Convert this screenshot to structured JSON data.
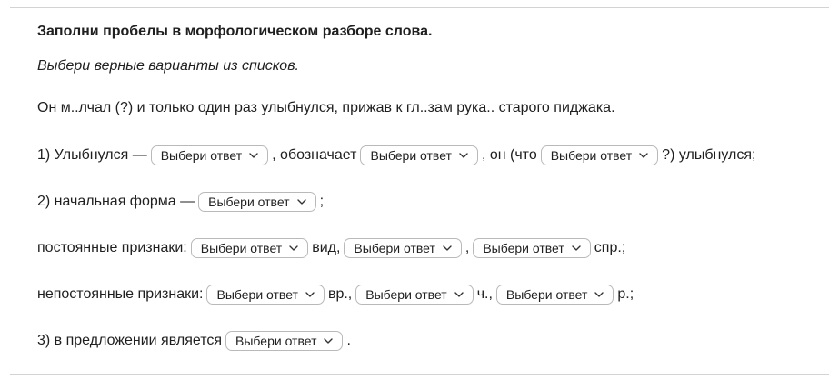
{
  "task": {
    "title": "Заполни пробелы в морфологическом разборе слова.",
    "instruction": "Выбери верные варианты из списков.",
    "sentence": "Он м..лчал (?) и только один раз улыбнулся, прижав к гл..зам рука.. старого пиджака."
  },
  "select_placeholder": "Выбери ответ",
  "rows": {
    "r1": {
      "prefix": "1) Улыбнулся —",
      "mid1": ", обозначает",
      "mid2": ", он (что",
      "suffix": "?) улыбнулся;"
    },
    "r2": {
      "prefix": "2) начальная форма —",
      "suffix": ";"
    },
    "r3": {
      "prefix": "постоянные признаки:",
      "mid1": "вид,",
      "mid2": ",",
      "suffix": "спр.;"
    },
    "r4": {
      "prefix": "непостоянные признаки:",
      "mid1": "вр.,",
      "mid2": "ч.,",
      "suffix": "р.;"
    },
    "r5": {
      "prefix": "3) в предложении является",
      "suffix": "."
    }
  }
}
